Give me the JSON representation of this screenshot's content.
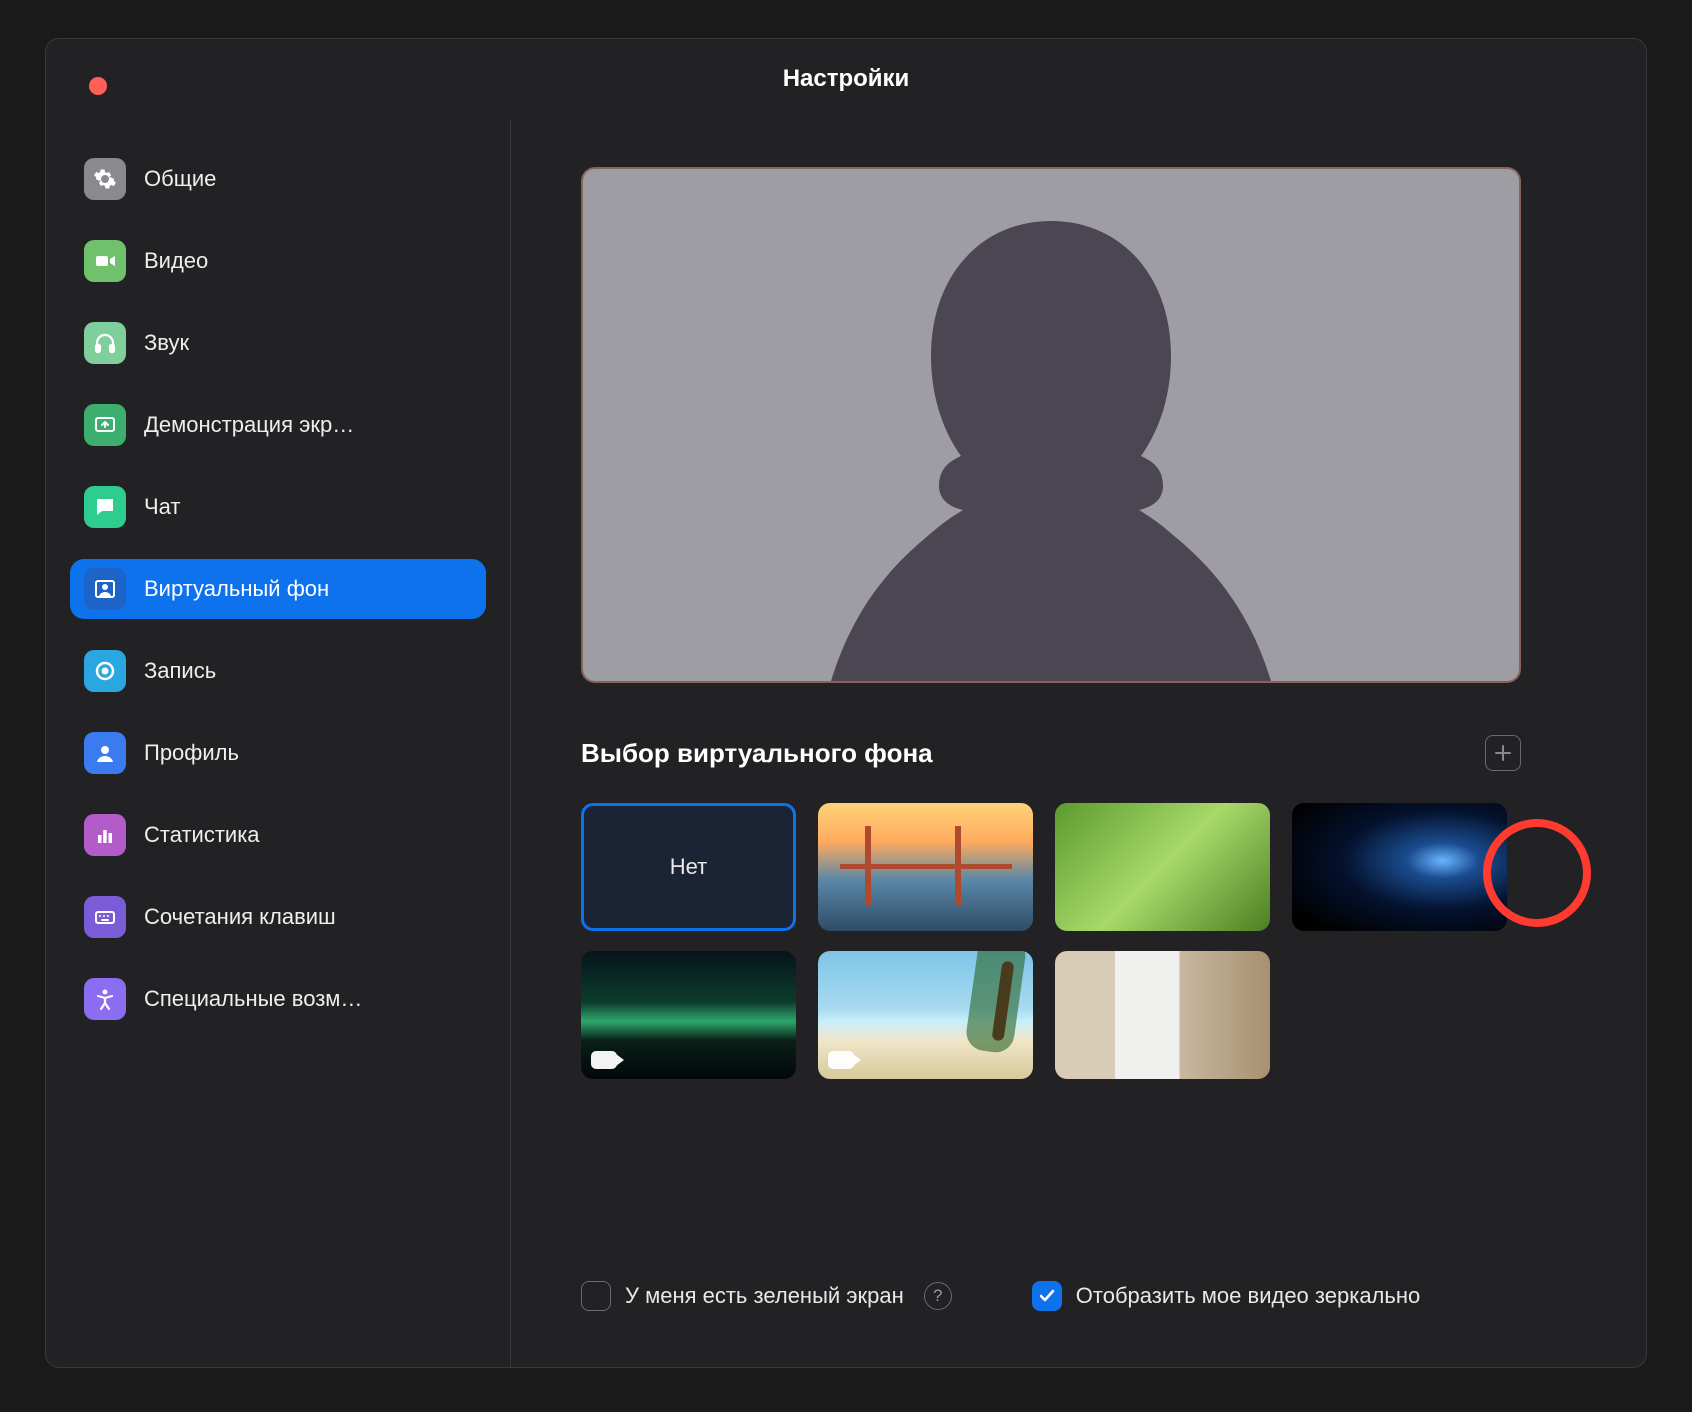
{
  "window": {
    "title": "Настройки"
  },
  "sidebar": {
    "items": [
      {
        "id": "general",
        "label": "Общие",
        "icon": "gear-icon",
        "color": "#8a8a8e"
      },
      {
        "id": "video",
        "label": "Видео",
        "icon": "video-icon",
        "color": "#6fc26b"
      },
      {
        "id": "audio",
        "label": "Звук",
        "icon": "headphones-icon",
        "color": "#7fcf9c"
      },
      {
        "id": "share",
        "label": "Демонстрация экр…",
        "icon": "share-screen-icon",
        "color": "#3caf6e"
      },
      {
        "id": "chat",
        "label": "Чат",
        "icon": "chat-icon",
        "color": "#2ecc8f"
      },
      {
        "id": "vbg",
        "label": "Виртуальный фон",
        "icon": "virtual-bg-icon",
        "color": "#0e72ed",
        "active": true
      },
      {
        "id": "recording",
        "label": "Запись",
        "icon": "record-icon",
        "color": "#2aa7e0"
      },
      {
        "id": "profile",
        "label": "Профиль",
        "icon": "profile-icon",
        "color": "#3a7bf0"
      },
      {
        "id": "stats",
        "label": "Статистика",
        "icon": "stats-icon",
        "color": "#b35cc9"
      },
      {
        "id": "shortcuts",
        "label": "Сочетания клавиш",
        "icon": "keyboard-icon",
        "color": "#7a5cd9"
      },
      {
        "id": "accessibility",
        "label": "Специальные возм…",
        "icon": "accessibility-icon",
        "color": "#8a6df0"
      }
    ]
  },
  "main": {
    "section_title": "Выбор виртуального фона",
    "backgrounds": [
      {
        "id": "none",
        "label": "Нет",
        "selected": true
      },
      {
        "id": "bridge",
        "label": "Golden Gate"
      },
      {
        "id": "grass",
        "label": "Grass"
      },
      {
        "id": "earth",
        "label": "Earth from space"
      },
      {
        "id": "aurora",
        "label": "Northern lights",
        "is_video": true
      },
      {
        "id": "beach",
        "label": "Beach",
        "is_video": true
      },
      {
        "id": "room",
        "label": "Interior room"
      }
    ],
    "checkboxes": {
      "green_screen": {
        "label": "У меня есть зеленый экран",
        "checked": false
      },
      "mirror": {
        "label": "Отобразить мое видео зеркально",
        "checked": true
      }
    }
  },
  "annotation": {
    "highlight_add_button": true,
    "color": "#ff3b30"
  }
}
